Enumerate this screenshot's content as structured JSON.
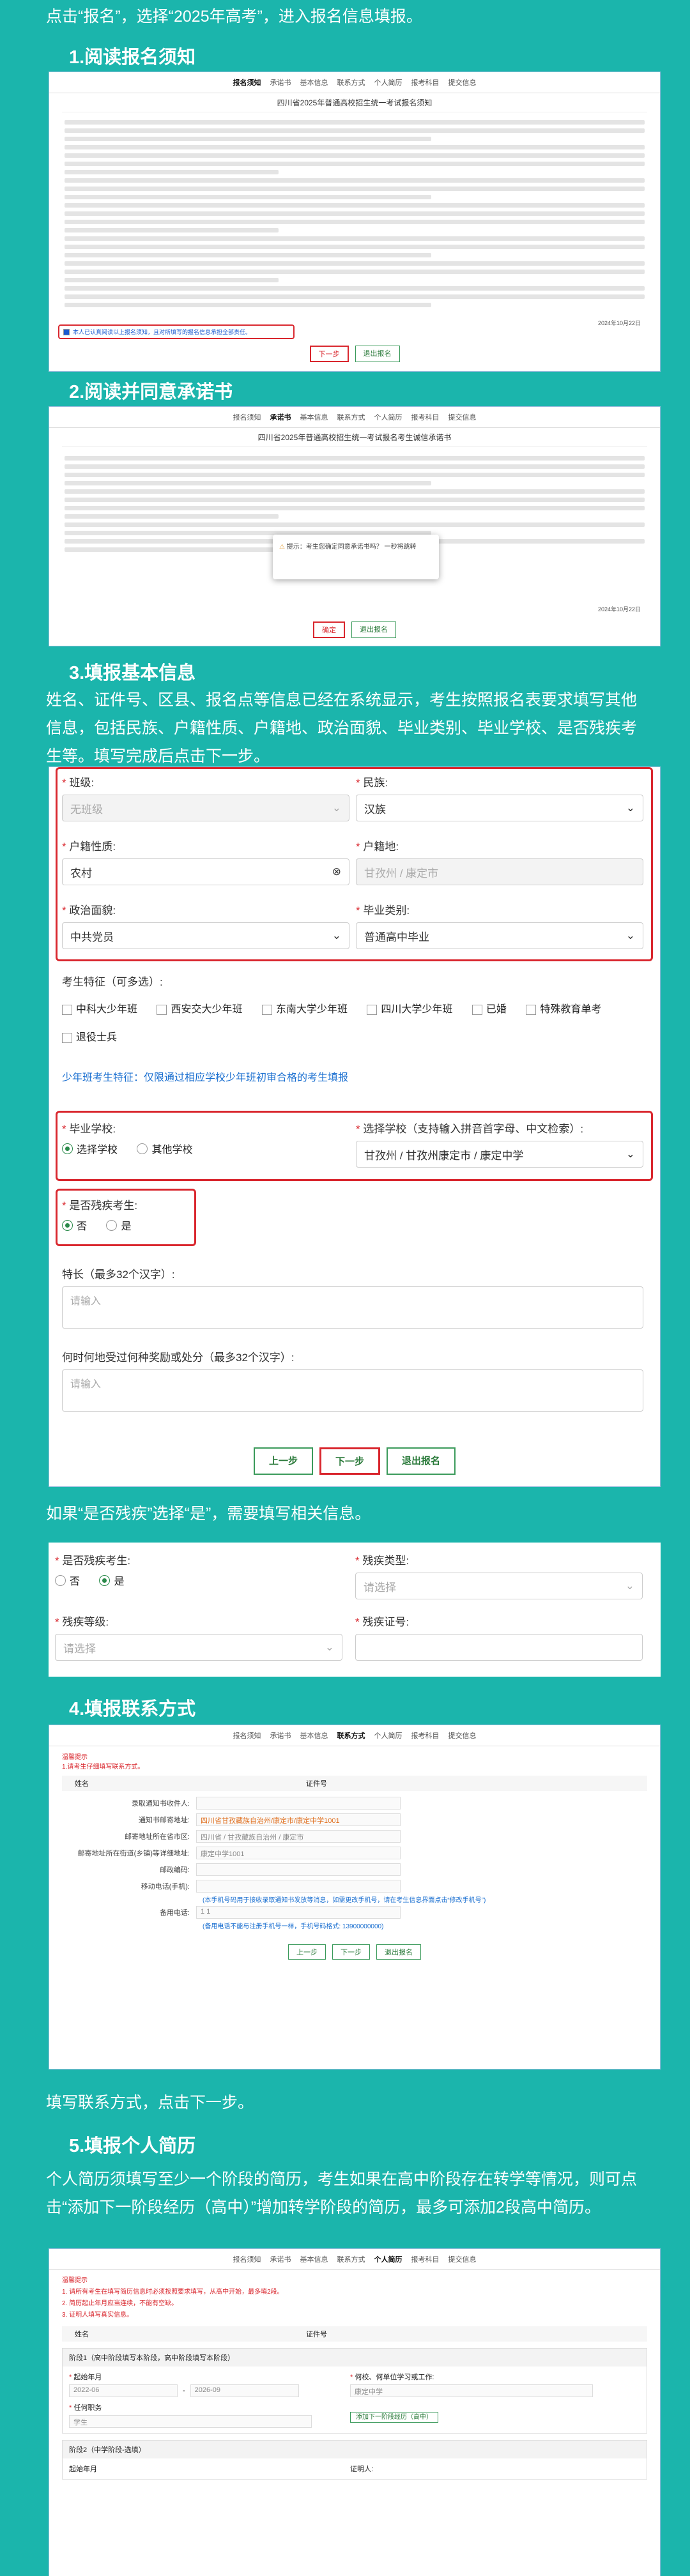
{
  "intro": "点击“报名”，选择“2025年高考”，进入报名信息填报。",
  "sec1": "1.阅读报名须知",
  "sec2": "2.阅读并同意承诺书",
  "sec3": "3.填报基本信息",
  "sec3_desc": "姓名、证件号、区县、报名点等信息已经在系统显示，考生按照报名表要求填写其他信息，包括民族、户籍性质、户籍地、政治面貌、毕业类别、毕业学校、是否残疾考生等。填写完成后点击下一步。",
  "disab_desc": "如果“是否残疾”选择“是”，需要填写相关信息。",
  "sec4": "4.填报联系方式",
  "sec4_desc": "填写联系方式，点击下一步。",
  "sec5": "5.填报个人简历",
  "sec5_desc": "个人简历须填写至少一个阶段的简历，考生如果在高中阶段存在转学等情况，则可点击“添加下一阶段经历（高中）”增加转学阶段的简历，最多可添加2段高中简历。",
  "steps1": [
    "报名须知",
    "承诺书",
    "基本信息",
    "联系方式",
    "个人简历",
    "报考科目",
    "提交信息"
  ],
  "shot1": {
    "title": "四川省2025年普通高校招生统一考试报名须知",
    "agree": "本人已认真阅读以上报名须知，且对所填写的报名信息承担全部责任。",
    "next": "下一步",
    "back": "退出报名",
    "date": "2024年10月22日"
  },
  "shot2": {
    "title": "四川省2025年普通高校招生统一考试报名考生诚信承诺书",
    "dialog": "提示：考生您确定同意承诺书吗？ 一秒将跳转",
    "btn_ok": "确定",
    "btn_back": "退出报名",
    "date": "2024年10月22日"
  },
  "form": {
    "class_label": "班级:",
    "class_val": "无班级",
    "nation_label": "民族:",
    "nation_val": "汉族",
    "huji_label": "户籍性质:",
    "huji_val": "农村",
    "hujidi_label": "户籍地:",
    "hujidi_val": "甘孜州 / 康定市",
    "zz_label": "政治面貌:",
    "zz_val": "中共党员",
    "bylb_label": "毕业类别:",
    "bylb_val": "普通高中毕业",
    "tz_label": "考生特征（可多选）:",
    "tz": [
      "中科大少年班",
      "西安交大少年班",
      "东南大学少年班",
      "四川大学少年班",
      "已婚",
      "特殊教育单考",
      "退役士兵"
    ],
    "shaonian": "少年班考生特征：仅限通过相应学校少年班初审合格的考生填报",
    "school_label": "毕业学校:",
    "school_opt1": "选择学校",
    "school_opt2": "其他学校",
    "sel_school_label": "选择学校（支持输入拼音首字母、中文检索）:",
    "sel_school_val": "甘孜州 / 甘孜州康定市 / 康定中学",
    "disab_label": "是否残疾考生:",
    "no": "否",
    "yes": "是",
    "tc_label": "特长（最多32个汉字）:",
    "placeholder": "请输入",
    "hj_label": "何时何地受过何种奖励或处分（最多32个汉字）:",
    "prev": "上一步",
    "next": "下一步",
    "exit": "退出报名"
  },
  "dis": {
    "label": "是否残疾考生:",
    "no": "否",
    "yes": "是",
    "type_label": "残疾类型:",
    "level_label": "残疾等级:",
    "cert_label": "残疾证号:",
    "ph_sel": "请选择"
  },
  "steps4": [
    "报名须知",
    "承诺书",
    "基本信息",
    "联系方式",
    "个人简历",
    "报考科目",
    "提交信息"
  ],
  "contact": {
    "warn": "温馨提示",
    "warn2": "1.请考生仔细填写联系方式。",
    "name": "姓名",
    "idno": "证件号",
    "rows": [
      {
        "l": "录取通知书收件人:",
        "v": ""
      },
      {
        "l": "通知书邮寄地址:",
        "v": "四川省甘孜藏族自治州/康定市/康定中学1001"
      },
      {
        "l": "邮寄地址所在省市区:",
        "v": "四川省 / 甘孜藏族自治州 / 康定市"
      },
      {
        "l": "邮寄地址所在街道(乡镇)等详细地址:",
        "v": "康定中学1001"
      },
      {
        "l": "邮政编码:",
        "v": ""
      },
      {
        "l": "移动电话(手机):",
        "v": ""
      },
      {
        "l": "备用电话:",
        "v": "1 1"
      }
    ],
    "note1": "(本手机号码用于接收录取通知书发放等消息，如需更改手机号，请在考生信息界面点击“修改手机号”)",
    "note2": "(备用电话不能与注册手机号一样，手机号码格式: 13900000000)",
    "prev": "上一步",
    "next": "下一步",
    "exit": "退出报名"
  },
  "resume": {
    "warn": "温馨提示",
    "w1": "1. 请所有考生在填写简历信息时必须按照要求填写，从高中开始，最多填2段。",
    "w2": "2. 简历起止年月应当连续，不能有空缺。",
    "w3": "3. 证明人填写真实信息。",
    "name": "姓名",
    "idno": "证件号",
    "stage1": "阶段1（高中阶段填写本阶段，高中阶段填写本阶段）",
    "start_label": "起始年月",
    "start_val": "2022-06",
    "end_val": "2026-09",
    "school_label": "何校、何单位学习或工作:",
    "school_val": "康定中学",
    "role_label": "任何职务",
    "role_val": "学生",
    "add_btn": "添加下一阶段经历（高中）",
    "stage2": "阶段2（中学阶段-选填）",
    "prover_label": "证明人:"
  }
}
